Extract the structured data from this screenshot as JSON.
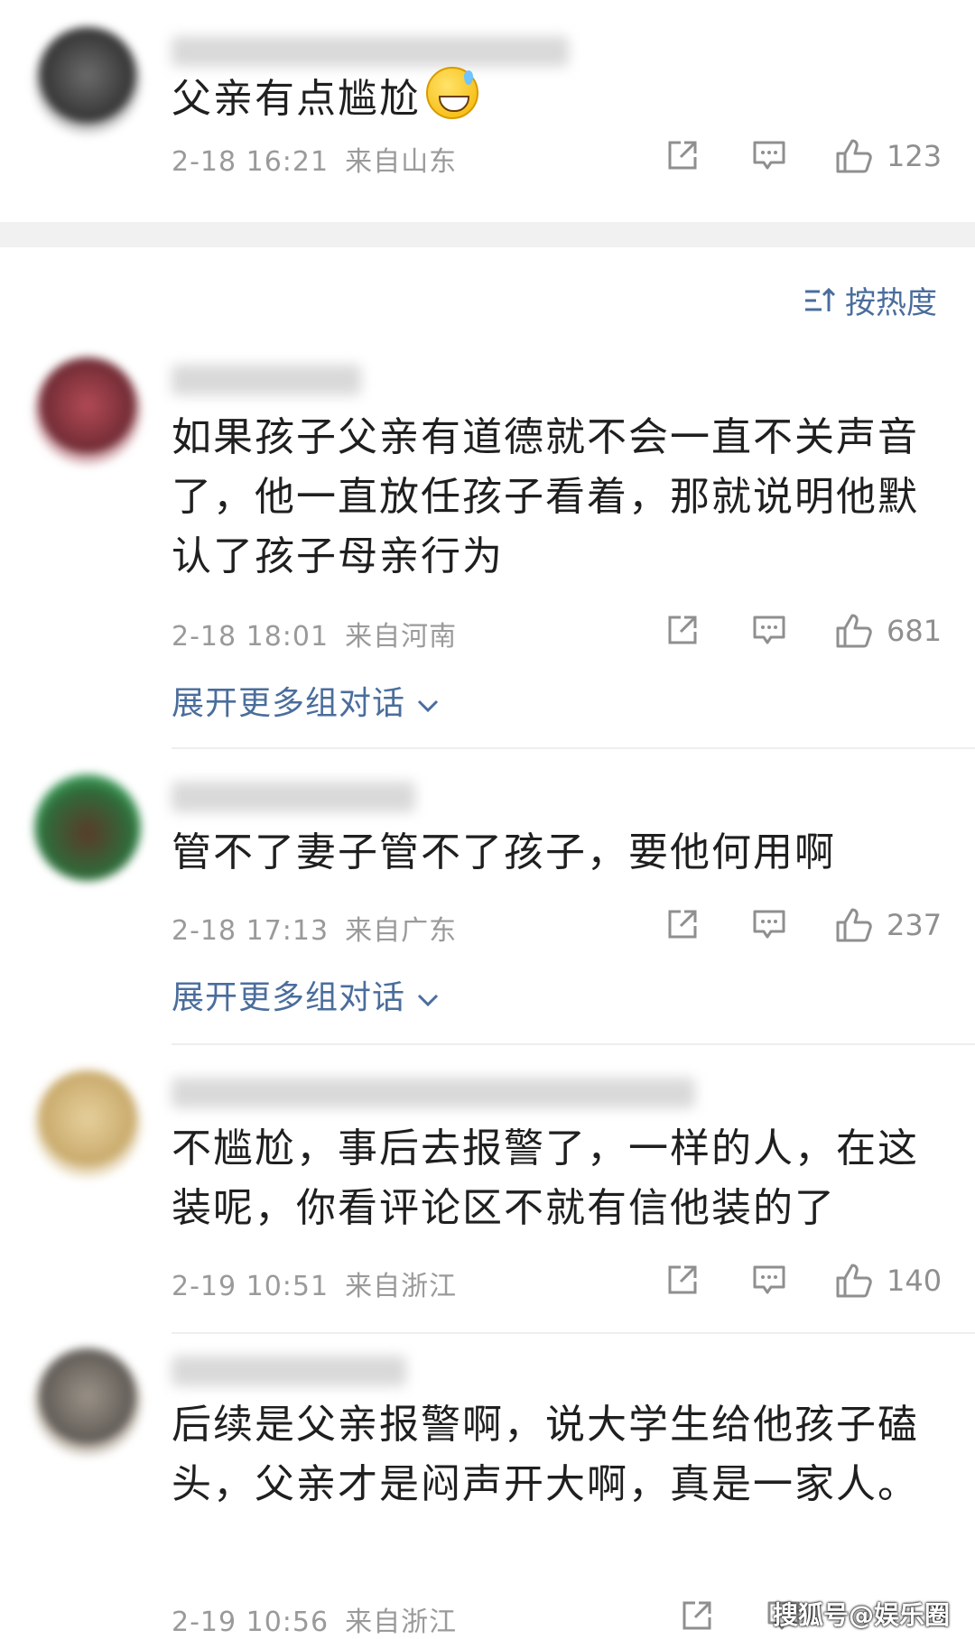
{
  "sort_label": "按热度",
  "expand_label": "展开更多组对话",
  "watermark": "搜狐号@娱乐圈",
  "colors": {
    "link": "#4a6d9c",
    "meta": "#9a9a9a",
    "divider": "#eeeeee"
  },
  "comments": [
    {
      "text": "父亲有点尴尬",
      "emoji": "sweat-smile-emoji",
      "time": "2-18 16:21",
      "location": "来自山东",
      "likes": "123"
    },
    {
      "text": "如果孩子父亲有道德就不会一直不关声音了，他一直放任孩子看着，那就说明他默认了孩子母亲行为",
      "time": "2-18 18:01",
      "location": "来自河南",
      "likes": "681"
    },
    {
      "text": "管不了妻子管不了孩子，要他何用啊",
      "time": "2-18 17:13",
      "location": "来自广东",
      "likes": "237"
    },
    {
      "text": "不尴尬，事后去报警了，一样的人，在这装呢，你看评论区不就有信他装的了",
      "time": "2-19 10:51",
      "location": "来自浙江",
      "likes": "140"
    },
    {
      "text": "后续是父亲报警啊，说大学生给他孩子磕头，父亲才是闷声开大啊，真是一家人。",
      "time": "2-19 10:56",
      "location": "来自浙江",
      "likes": ""
    }
  ]
}
